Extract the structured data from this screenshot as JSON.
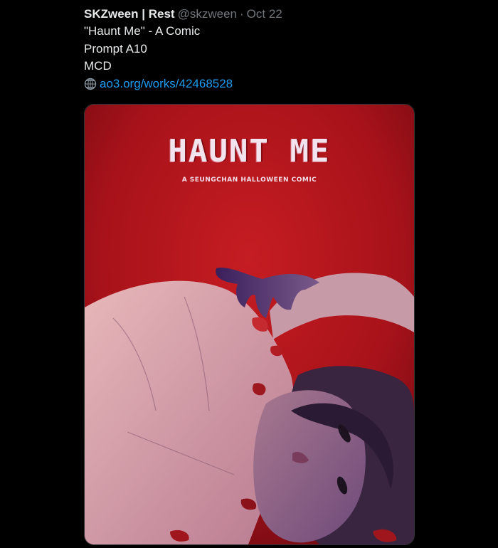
{
  "tweet": {
    "author_name": "SKZween | Rest",
    "author_handle": "@skzween",
    "separator": "·",
    "timestamp": "Oct 22",
    "lines": [
      "\"Haunt Me\" - A Comic",
      "Prompt A10",
      "MCD"
    ],
    "link_icon": "web-icon",
    "link_text": "ao3.org/works/42468528"
  },
  "media": {
    "cover_title": "HAUNT ME",
    "cover_subtitle": "A SEUNGCHAN HALLOWEEN COMIC"
  },
  "colors": {
    "background": "#000000",
    "text": "#e7e9ea",
    "secondary_text": "#71767b",
    "link": "#1d9bf0",
    "cover_red": "#b5161b"
  }
}
